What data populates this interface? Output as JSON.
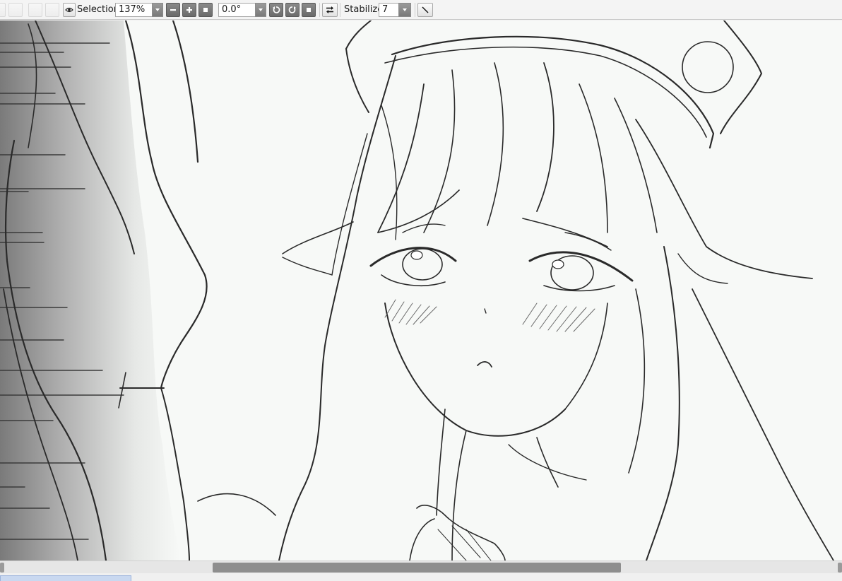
{
  "toolbar": {
    "selection_label": "Selection",
    "zoom_value": "137%",
    "rotation_value": "0.0°",
    "stabilizer_label": "Stabilizer",
    "stabilizer_value": "7"
  },
  "icons": {
    "visibility": "eye-icon",
    "zoom_out": "minus-icon",
    "zoom_in": "plus-icon",
    "zoom_reset": "square-icon",
    "rotate_ccw": "rotate-left-icon",
    "rotate_cw": "rotate-right-icon",
    "rotate_reset": "square-icon",
    "flip": "swap-arrows-icon",
    "pen": "diagonal-line-icon"
  },
  "scrollbar": {
    "position_fraction": 0.25,
    "visible_fraction": 0.49
  }
}
